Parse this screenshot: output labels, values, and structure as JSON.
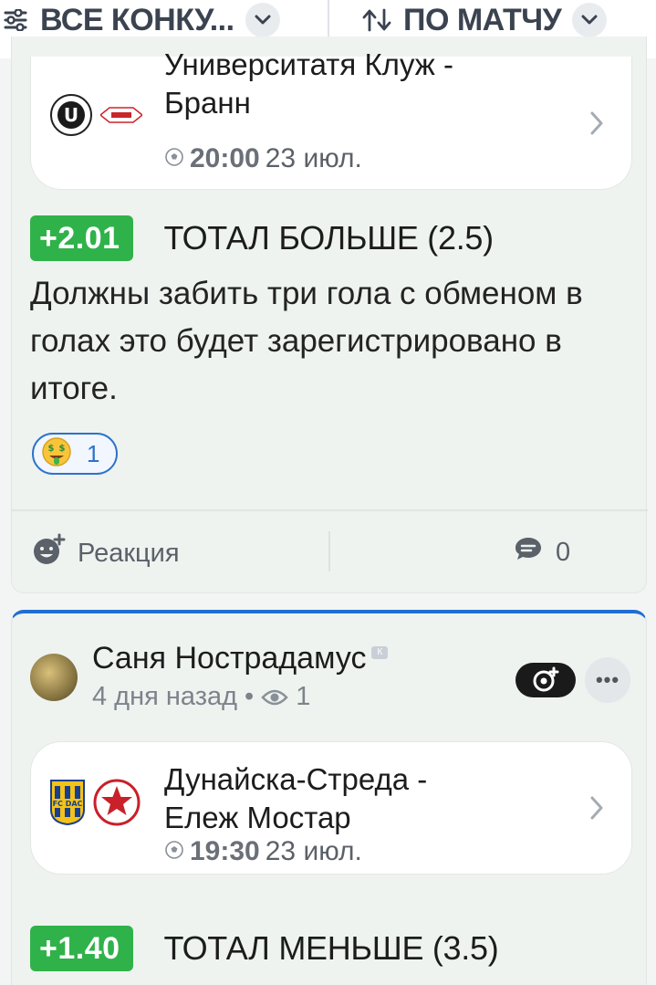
{
  "filters": {
    "left_label": "ВСЕ КОНКУ...",
    "right_label": "ПО МАТЧУ"
  },
  "posts": [
    {
      "match": {
        "teams_line1": "Университатя Клуж -",
        "teams_line2": "Бранн",
        "time": "20:00",
        "date": "23 июл."
      },
      "pick": {
        "odds": "+2.01",
        "market": "ТОТАЛ БОЛЬШЕ (2.5)"
      },
      "comment": "Должны забить три гола с обменом в голах это будет зарегистрировано в итоге.",
      "reaction_count": "1",
      "actions": {
        "reaction_label": "Реакция",
        "comments_count": "0"
      }
    },
    {
      "author": {
        "name": "Саня Нострадамус",
        "ago": "4 дня назад",
        "views": "1"
      },
      "match": {
        "teams_line1": "Дунайска-Стреда -",
        "teams_line2": "Ележ Мостар",
        "time": "19:30",
        "date": "23 июл."
      },
      "pick": {
        "odds": "+1.40",
        "market": "ТОТАЛ МЕНЬШЕ (3.5)"
      }
    }
  ],
  "colors": {
    "odds_green": "#2fb24a",
    "accent_blue": "#1f6fd1"
  }
}
